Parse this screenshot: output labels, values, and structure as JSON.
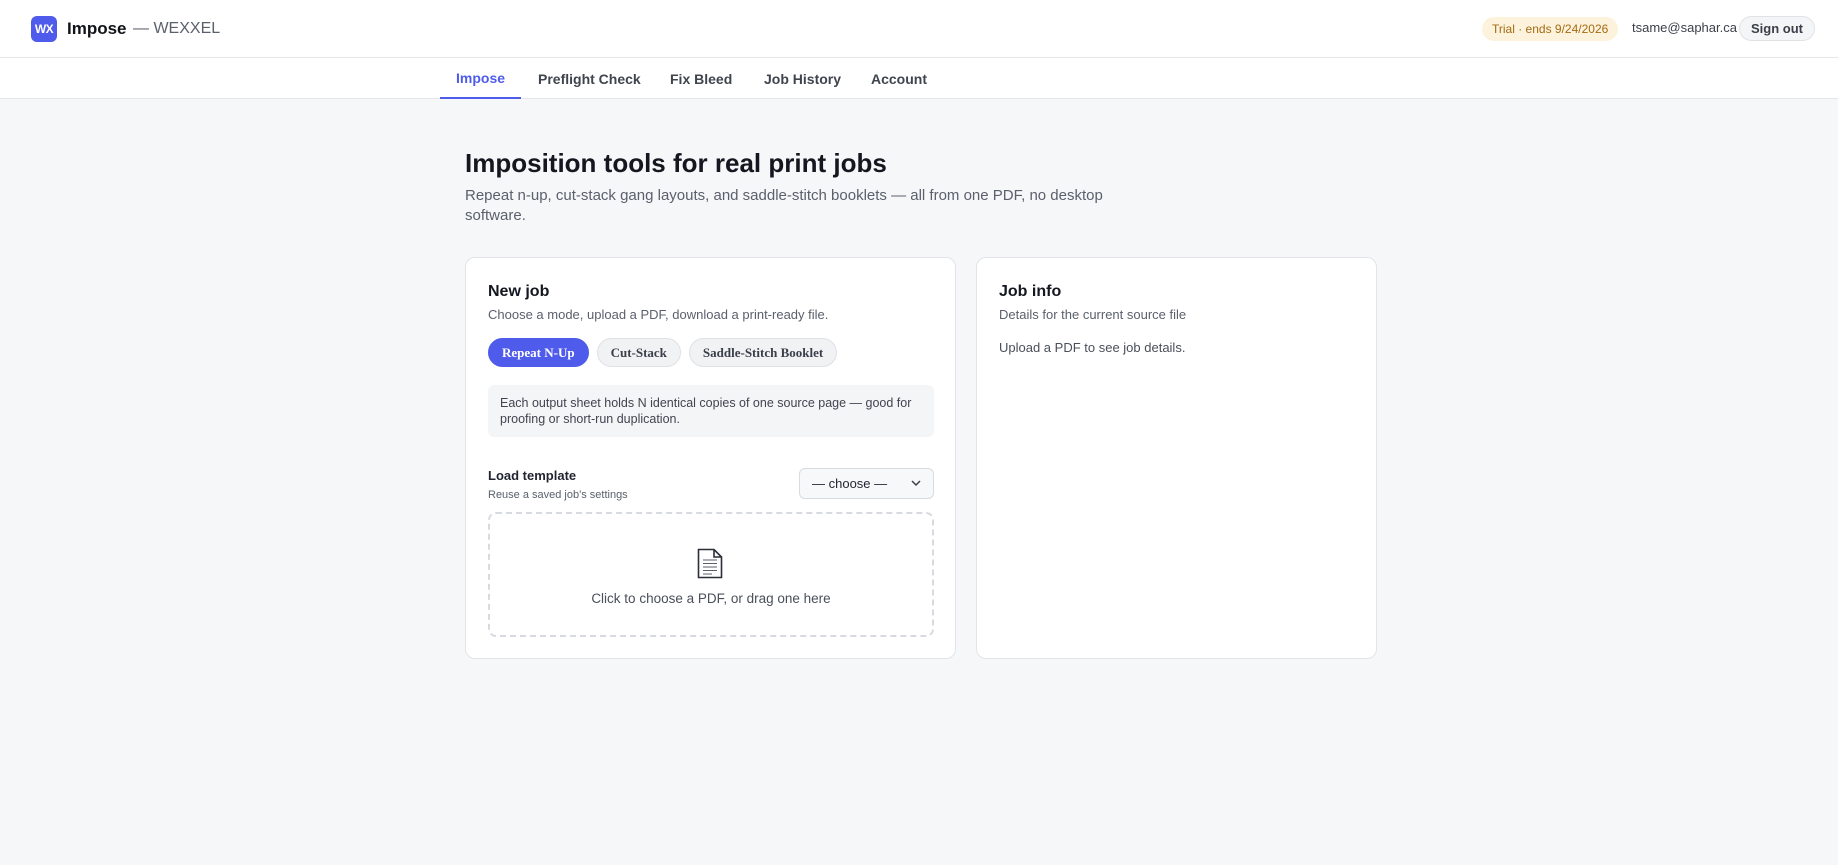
{
  "header": {
    "logo_text": "WX",
    "app_name": "Impose",
    "org_name": "— WEXXEL",
    "trial_badge": "Trial · ends 9/24/2026",
    "user_email": "tsame@saphar.ca",
    "signout_label": "Sign out"
  },
  "nav": {
    "tabs": [
      {
        "label": "Impose",
        "active": true
      },
      {
        "label": "Preflight Check",
        "active": false
      },
      {
        "label": "Fix Bleed",
        "active": false
      },
      {
        "label": "Job History",
        "active": false
      },
      {
        "label": "Account",
        "active": false
      }
    ]
  },
  "hero": {
    "title": "Imposition tools for real print jobs",
    "subtitle": "Repeat n-up, cut-stack gang layouts, and saddle-stitch booklets — all from one PDF, no desktop software."
  },
  "new_job": {
    "title": "New job",
    "subtitle": "Choose a mode, upload a PDF, download a print-ready file.",
    "modes": [
      {
        "label": "Repeat N-Up",
        "active": true
      },
      {
        "label": "Cut-Stack",
        "active": false
      },
      {
        "label": "Saddle-Stitch Booklet",
        "active": false
      }
    ],
    "mode_description": "Each output sheet holds N identical copies of one source page — good for proofing or short-run duplication.",
    "template_label": "Load template",
    "template_hint": "Reuse a saved job's settings",
    "template_selected": "— choose —",
    "dropzone_text": "Click to choose a PDF, or drag one here",
    "dropzone_icon": "document-icon"
  },
  "job_info": {
    "title": "Job info",
    "subtitle": "Details for the current source file",
    "empty_text": "Upload a PDF to see job details."
  },
  "colors": {
    "accent": "#4f5bea",
    "trial_bg": "#fdf3dc",
    "trial_text": "#a46a12",
    "page_bg": "#f6f7f9"
  }
}
